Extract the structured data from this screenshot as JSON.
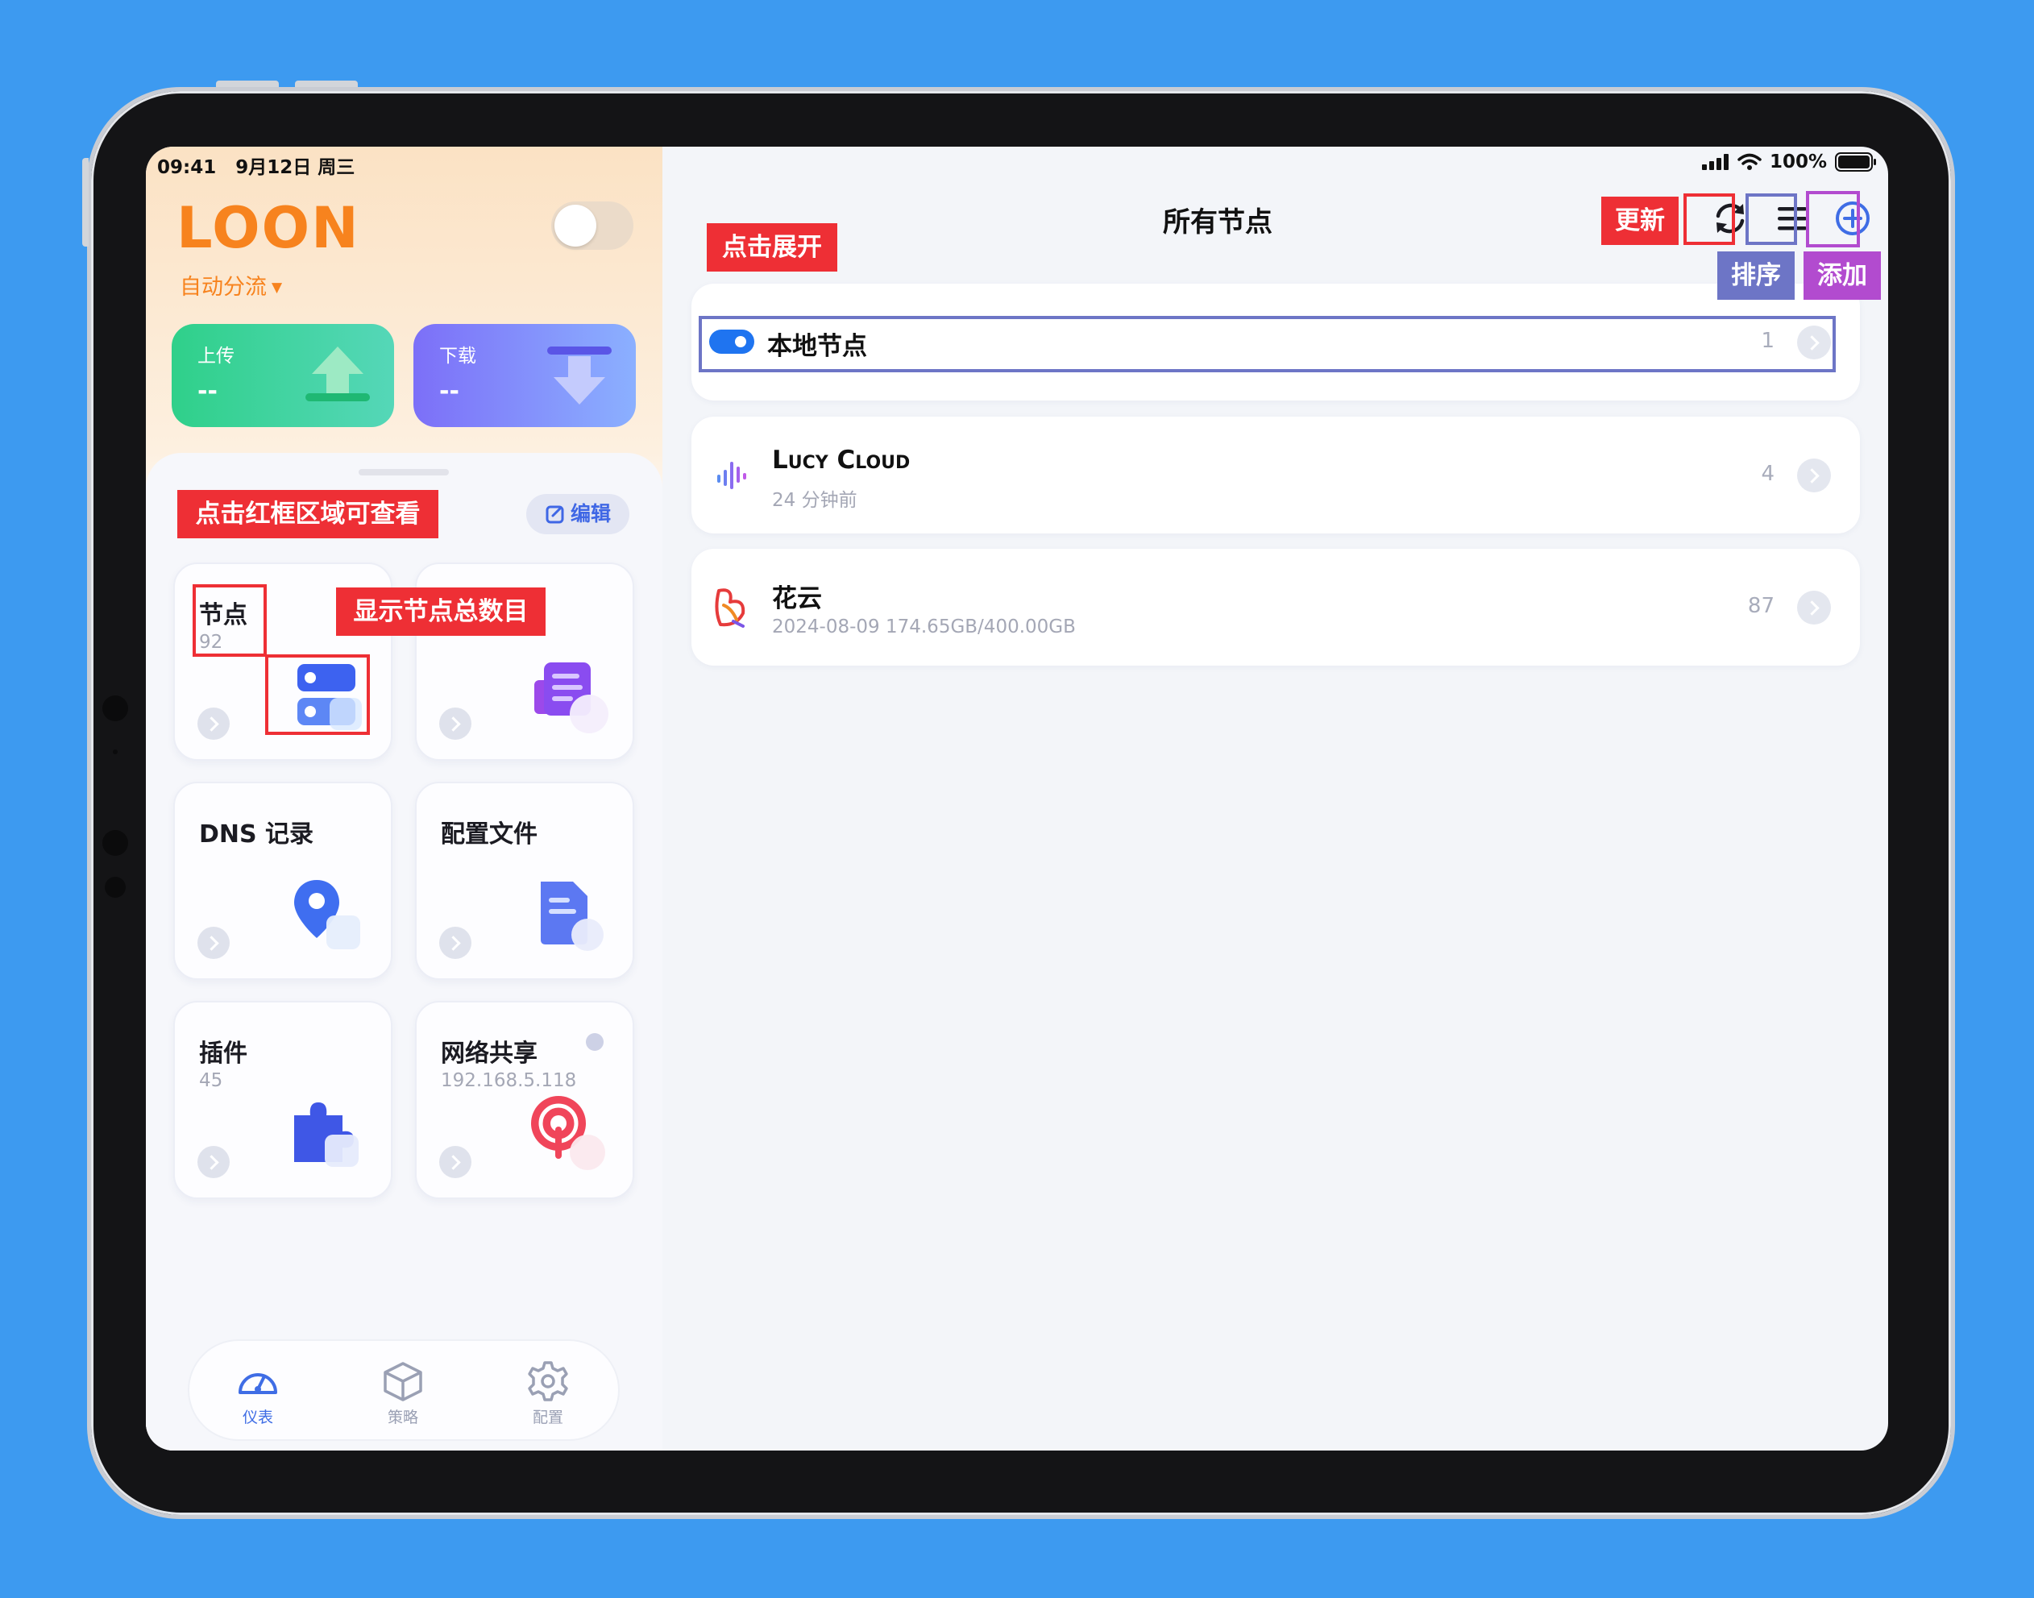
{
  "status": {
    "time": "09:41",
    "date": "9月12日 周三",
    "battery": "100%"
  },
  "app": {
    "brand": "LOON",
    "mode": "自动分流"
  },
  "traffic": {
    "upload_label": "上传",
    "upload_value": "--",
    "download_label": "下载",
    "download_value": "--"
  },
  "edit_label": "编辑",
  "tiles": [
    {
      "title": "节点",
      "sub": "92"
    },
    {
      "title": "",
      "sub": ""
    },
    {
      "title": "DNS 记录",
      "sub": ""
    },
    {
      "title": "配置文件",
      "sub": ""
    },
    {
      "title": "插件",
      "sub": "45"
    },
    {
      "title": "网络共享",
      "sub": "192.168.5.118"
    }
  ],
  "tabs": [
    {
      "label": "仪表",
      "icon": "gauge-icon",
      "active": true
    },
    {
      "label": "策略",
      "icon": "cube-icon",
      "active": false
    },
    {
      "label": "配置",
      "icon": "gear-icon",
      "active": false
    }
  ],
  "right": {
    "title": "所有节点",
    "nodes": [
      {
        "name": "本地节点",
        "sub": "",
        "count": "1",
        "toggle_on": true
      },
      {
        "name": "Lucy Cloud",
        "sub": "24 分钟前",
        "count": "4",
        "icon": "soundwave-icon"
      },
      {
        "name": "花云",
        "sub": "2024-08-09 174.65GB/400.00GB",
        "count": "87",
        "icon": "flower-logo-icon"
      }
    ]
  },
  "annotations": {
    "expand": "点击展开",
    "refresh": "更新",
    "sort": "排序",
    "add": "添加",
    "view_hint": "点击红框区域可查看",
    "node_count_hint": "显示节点总数目"
  },
  "colors": {
    "background": "#3d9af0",
    "brand": "#f7831e",
    "accent": "#3f6de5",
    "upload": "#2fd08a",
    "download": "#7c6ff8",
    "annotation_red": "#ee2f35",
    "annotation_indigo": "#6d75c6",
    "annotation_purple": "#b24bcf"
  }
}
